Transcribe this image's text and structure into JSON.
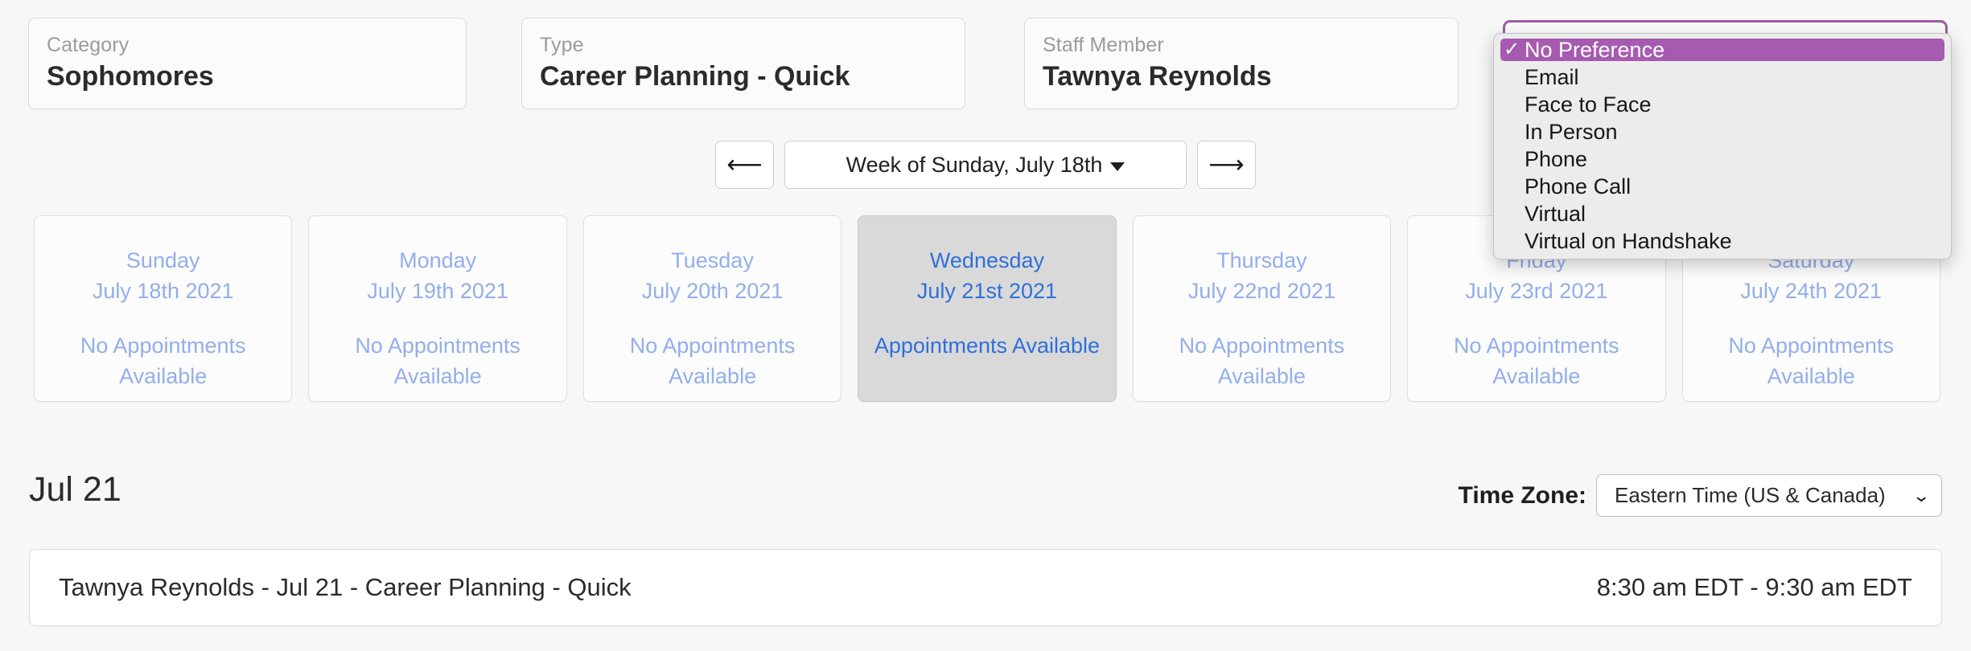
{
  "filters": [
    {
      "label": "Category",
      "value": "Sophomores"
    },
    {
      "label": "Type",
      "value": "Career Planning - Quick"
    },
    {
      "label": "Staff Member",
      "value": "Tawnya Reynolds"
    }
  ],
  "week_nav": {
    "prev_icon": "arrow-left-icon",
    "next_icon": "arrow-right-icon",
    "label": "Week of Sunday, July 18th"
  },
  "days": [
    {
      "name": "Sunday",
      "date": "July 18th 2021",
      "status": "No Appointments Available",
      "selected": false
    },
    {
      "name": "Monday",
      "date": "July 19th 2021",
      "status": "No Appointments Available",
      "selected": false
    },
    {
      "name": "Tuesday",
      "date": "July 20th 2021",
      "status": "No Appointments Available",
      "selected": false
    },
    {
      "name": "Wednesday",
      "date": "July 21st 2021",
      "status": "Appointments Available",
      "selected": true
    },
    {
      "name": "Thursday",
      "date": "July 22nd 2021",
      "status": "No Appointments Available",
      "selected": false
    },
    {
      "name": "Friday",
      "date": "July 23rd 2021",
      "status": "No Appointments Available",
      "selected": false
    },
    {
      "name": "Saturday",
      "date": "July 24th 2021",
      "status": "No Appointments Available",
      "selected": false
    }
  ],
  "schedule": {
    "date_heading": "Jul 21",
    "timezone_label": "Time Zone:",
    "timezone_value": "Eastern Time (US & Canada)",
    "appointment": {
      "title": "Tawnya Reynolds - Jul 21 - Career Planning - Quick",
      "time": "8:30 am EDT - 9:30 am EDT"
    }
  },
  "modality_dropdown": {
    "border_color": "#a05ba8",
    "highlight_color": "#a65bb0",
    "check_glyph": "✓",
    "options": [
      {
        "label": "No Preference",
        "selected": true
      },
      {
        "label": "Email",
        "selected": false
      },
      {
        "label": "Face to Face",
        "selected": false
      },
      {
        "label": "In Person",
        "selected": false
      },
      {
        "label": "Phone",
        "selected": false
      },
      {
        "label": "Phone Call",
        "selected": false
      },
      {
        "label": "Virtual",
        "selected": false
      },
      {
        "label": "Virtual on Handshake",
        "selected": false
      }
    ]
  }
}
